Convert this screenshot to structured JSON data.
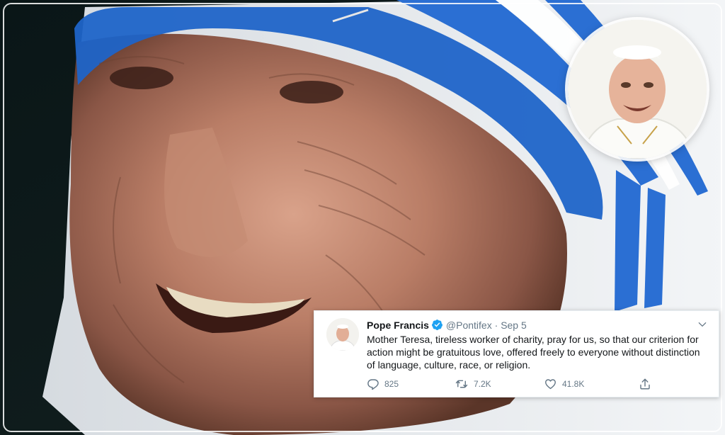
{
  "tweet": {
    "name": "Pope Francis",
    "handle": "@Pontifex",
    "separator": "·",
    "date": "Sep 5",
    "text": "Mother Teresa, tireless worker of charity, pray for us, so that our criterion for action might be gratuitous love, offered freely to everyone without distinction of language, culture, race, or religion.",
    "replies": "825",
    "retweets": "7.2K",
    "likes": "41.8K"
  },
  "icons": {
    "verified": "verified-badge-icon",
    "caret": "chevron-down-icon",
    "reply": "reply-icon",
    "retweet": "retweet-icon",
    "like": "heart-icon",
    "share": "share-icon"
  },
  "colors": {
    "verified": "#1da1f2",
    "text": "#14171a",
    "muted": "#657786",
    "sari_blue": "#1f64c8"
  }
}
